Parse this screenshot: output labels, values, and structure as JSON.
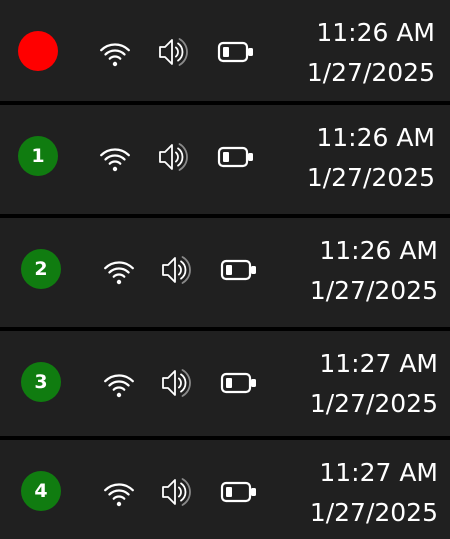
{
  "taskbar_tray_strips": [
    {
      "indicator": {
        "type": "recording-dot",
        "label": "",
        "color": "#ff0000"
      },
      "tray_icons": [
        "wifi-icon",
        "volume-icon",
        "battery-icon"
      ],
      "clock": {
        "time": "11:26 AM",
        "date": "1/27/2025"
      }
    },
    {
      "indicator": {
        "type": "step-badge",
        "label": "1",
        "color": "#107c10"
      },
      "tray_icons": [
        "wifi-icon",
        "volume-icon",
        "battery-icon"
      ],
      "clock": {
        "time": "11:26 AM",
        "date": "1/27/2025"
      }
    },
    {
      "indicator": {
        "type": "step-badge",
        "label": "2",
        "color": "#107c10"
      },
      "tray_icons": [
        "wifi-icon",
        "volume-icon",
        "battery-icon"
      ],
      "clock": {
        "time": "11:26 AM",
        "date": "1/27/2025"
      }
    },
    {
      "indicator": {
        "type": "step-badge",
        "label": "3",
        "color": "#107c10"
      },
      "tray_icons": [
        "wifi-icon",
        "volume-icon",
        "battery-icon"
      ],
      "clock": {
        "time": "11:27 AM",
        "date": "1/27/2025"
      }
    },
    {
      "indicator": {
        "type": "step-badge",
        "label": "4",
        "color": "#107c10"
      },
      "tray_icons": [
        "wifi-icon",
        "volume-icon",
        "battery-icon"
      ],
      "clock": {
        "time": "11:27 AM",
        "date": "1/27/2025"
      }
    }
  ],
  "colors": {
    "tray_background": "#202020",
    "separator": "#000000",
    "foreground": "#ffffff",
    "recording_dot": "#ff0000",
    "step_badge": "#107c10"
  }
}
